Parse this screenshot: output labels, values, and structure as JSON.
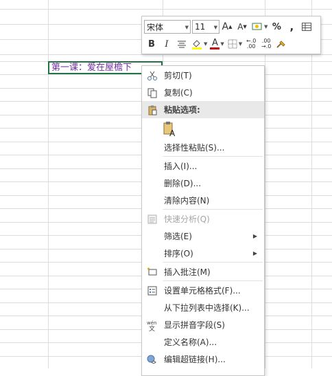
{
  "cell": {
    "text": "第一课：爱在屋檐下"
  },
  "toolbar": {
    "font_name": "宋体",
    "font_size": "11",
    "grow_font": "A",
    "shrink_font": "A",
    "percent": "%",
    "comma": ",",
    "bold": "B",
    "italic": "I",
    "font_color_letter": "A",
    "increase_decimal": "←.0\n.00",
    "decrease_decimal": ".00\n→.0",
    "colors": {
      "font_color": "#c00000",
      "fill_color": "#ffff00"
    }
  },
  "menu": {
    "cut": "剪切(T)",
    "copy": "复制(C)",
    "paste_options": "粘贴选项:",
    "paste_special": "选择性粘贴(S)...",
    "insert": "插入(I)...",
    "delete": "删除(D)...",
    "clear_contents": "清除内容(N)",
    "quick_analysis": "快速分析(Q)",
    "filter": "筛选(E)",
    "sort": "排序(O)",
    "insert_comment": "插入批注(M)",
    "format_cells": "设置单元格格式(F)...",
    "pick_from_list": "从下拉列表中选择(K)...",
    "show_phonetic": "显示拼音字段(S)",
    "define_name": "定义名称(A)...",
    "edit_hyperlink": "编辑超链接(H)..."
  },
  "icons": {
    "cut": "scissors-icon",
    "copy": "copy-icon",
    "paste": "clipboard-icon",
    "quick_analysis": "quick-analysis-icon",
    "comment": "comment-icon",
    "format": "format-cells-icon",
    "phonetic": "phonetic-icon",
    "hyperlink": "hyperlink-icon"
  }
}
